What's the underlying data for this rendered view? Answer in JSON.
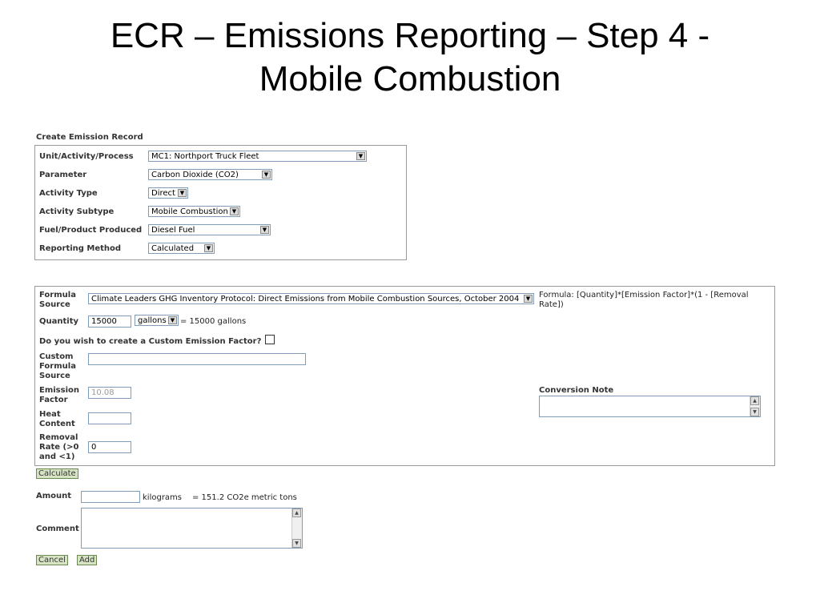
{
  "title_line1": "ECR – Emissions Reporting – Step 4 -",
  "title_line2": "Mobile Combustion",
  "section_title": "Create Emission Record",
  "record": {
    "unit_label": "Unit/Activity/Process",
    "unit_value": "MC1: Northport Truck Fleet",
    "parameter_label": "Parameter",
    "parameter_value": "Carbon Dioxide (CO2)",
    "activity_type_label": "Activity Type",
    "activity_type_value": "Direct",
    "activity_subtype_label": "Activity Subtype",
    "activity_subtype_value": "Mobile Combustion",
    "fuel_label": "Fuel/Product Produced",
    "fuel_value": "Diesel Fuel",
    "reporting_method_label": "Reporting Method",
    "reporting_method_value": "Calculated"
  },
  "formula": {
    "source_label_1": "Formula",
    "source_label_2": "Source",
    "source_value": "Climate Leaders GHG Inventory Protocol:  Direct Emissions from Mobile Combustion Sources, October 2004",
    "formula_text_1": "Formula: [Quantity]*[Emission Factor]*(1 - [Removal",
    "formula_text_2": "Rate])",
    "quantity_label": "Quantity",
    "quantity_value": "15000",
    "quantity_unit": "gallons",
    "quantity_result": "= 15000 gallons",
    "custom_factor_question": "Do you wish to create a Custom Emission Factor?",
    "custom_source_label_1": "Custom",
    "custom_source_label_2": "Formula",
    "custom_source_label_3": "Source",
    "custom_source_value": "",
    "emission_factor_label_1": "Emission",
    "emission_factor_label_2": "Factor",
    "emission_factor_value": "10.08",
    "heat_content_label_1": "Heat",
    "heat_content_label_2": "Content",
    "heat_content_value": "",
    "removal_rate_label_1": "Removal",
    "removal_rate_label_2": "Rate (>0",
    "removal_rate_label_3": "and <1)",
    "removal_rate_value": "0",
    "conversion_note_label": "Conversion Note"
  },
  "calculate_label": "Calculate",
  "amount": {
    "label": "Amount",
    "value": "",
    "unit": "kilograms",
    "result": "= 151.2 CO2e metric tons"
  },
  "comment_label": "Comment",
  "cancel_label": "Cancel",
  "add_label": "Add"
}
